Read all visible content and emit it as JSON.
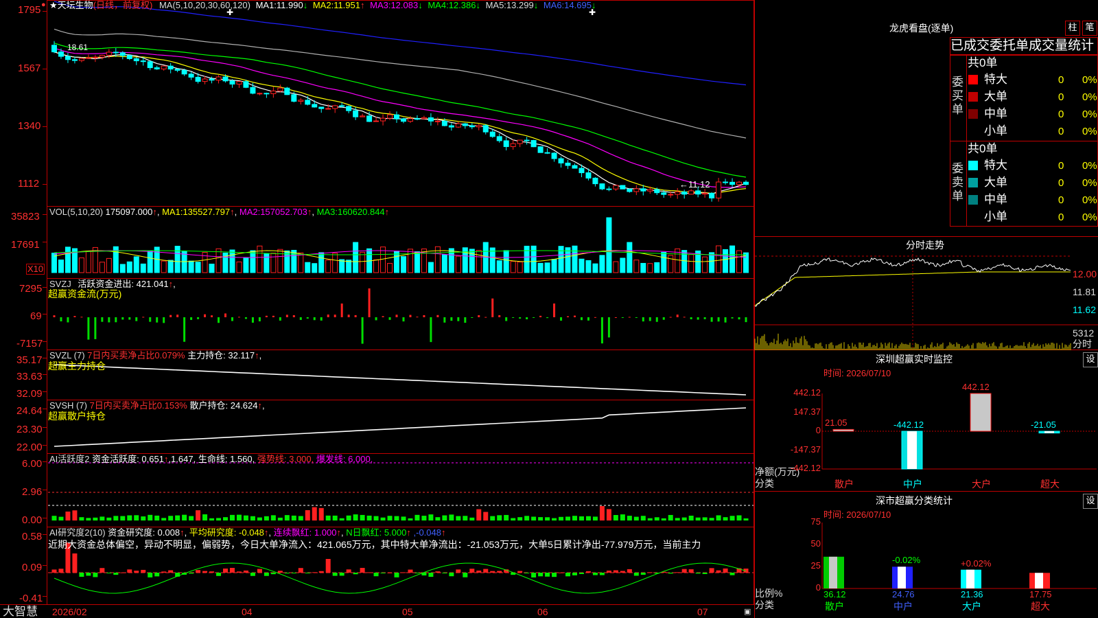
{
  "app": {
    "name": "大智慧",
    "corner_icon": "alert-icon"
  },
  "stock": {
    "star": "★",
    "name": "天坛生物",
    "period": "(日线，前复权)"
  },
  "colors": {
    "up": "#ff2020",
    "down": "#00ffff",
    "ma1": "#ffffff",
    "ma2": "#ffff00",
    "ma3": "#ff00ff",
    "ma4": "#00ff00",
    "ma5": "#b0b0b0",
    "ma6": "#2020ff",
    "panel_border": "#c00000"
  },
  "price_panel": {
    "indicator": "MA(5,10,20,30,60,120)",
    "ma": [
      {
        "name": "MA1:",
        "value": "11.990",
        "arrow": "↓"
      },
      {
        "name": "MA2:",
        "value": "11.951",
        "arrow": "↑"
      },
      {
        "name": "MA3:",
        "value": "12.083",
        "arrow": "↓"
      },
      {
        "name": "MA4:",
        "value": "12.386",
        "arrow": "↓"
      },
      {
        "name": "MA5:",
        "value": "13.299",
        "arrow": "↓"
      },
      {
        "name": "MA6:",
        "value": "14.695",
        "arrow": "↓"
      }
    ],
    "y_ticks": [
      "1795",
      "1567",
      "1340",
      "1112"
    ],
    "high_label": "18.61",
    "low_label": "←11.12"
  },
  "vol_panel": {
    "indicator": "VOL(5,10,20)",
    "value": "175097.000",
    "arrow": "↑",
    "ma": [
      {
        "name": "MA1:",
        "value": "135527.797",
        "arrow": "↑"
      },
      {
        "name": "MA2:",
        "value": "157052.703",
        "arrow": "↑"
      },
      {
        "name": "MA3:",
        "value": "160620.844",
        "arrow": "↑"
      }
    ],
    "y_ticks": [
      "35823",
      "17691"
    ],
    "unit": "X10"
  },
  "svzj_panel": {
    "indicator": "SVZJ",
    "label": "活跃资金进出:",
    "value": "421.041",
    "arrow": "↑",
    ",": ",",
    "subtitle": "超赢资金流(万元)",
    "y_ticks": [
      "7295",
      "69",
      "-7157"
    ]
  },
  "svzl_panel": {
    "indicator": "SVZL (7)",
    "ratio": "7日内买卖净占比0.079%",
    "label": "主力持仓:",
    "value": "32.117",
    "arrow": "↑",
    "sep": ",",
    "subtitle": "超赢主力持仓",
    "y_ticks": [
      "35.17",
      "33.63",
      "32.09"
    ]
  },
  "svsh_panel": {
    "indicator": "SVSH (7)",
    "ratio": "7日内买卖净占比0.153%",
    "label": "散户持仓:",
    "value": "24.624",
    "arrow": "↑",
    "sep": ",",
    "subtitle": "超赢散户持仓",
    "y_ticks": [
      "24.64",
      "23.30",
      "22.00"
    ]
  },
  "ai_active_panel": {
    "indicator": "AI活跃度2",
    "label": "资金活跃度:",
    "v1": "0.651",
    "a1": "↑",
    "v2": ",1.647,",
    "life": "生命线:",
    "life_v": "1.560,",
    "strong": "强势线:",
    "strong_v": "3.000,",
    "burst": "爆发线:",
    "burst_v": "6.000,",
    "y_ticks": [
      "6.00",
      "2.96",
      "0.00"
    ]
  },
  "ai_research_panel": {
    "indicator": "AI研究度2(10)",
    "l1": "资金研究度:",
    "v1": "0.008",
    "a1": "↑",
    "l2": "平均研究度:",
    "v2": "-0.048",
    "a2": "↑",
    "l3": "连续飘红:",
    "v3": "1.000",
    "a3": "↑",
    "l4": "N日飘红:",
    "v4": "5.000",
    "a4": "↑",
    "v5": ",-0.048",
    "a5": "↑",
    "comment": "近期大资金总体偏空，异动不明显，偏弱势，今日大单净流入：421.065万元，其中特大单净流出：-21.053万元，大单5日累计净出-77.979万元，当前主力",
    "y_ticks": [
      "0.58",
      "0.09",
      "-0.41"
    ]
  },
  "x_axis": {
    "labels": [
      "2026/02",
      "04",
      "05",
      "06",
      "07"
    ]
  },
  "dragon": {
    "title": "龙虎看盘(逐单)",
    "btn_col": "柱",
    "btn_pen": "笔",
    "tabs": [
      "已成交",
      "委托单",
      "成交量",
      "统计"
    ],
    "buy": {
      "side": "委买单",
      "total": "共0单",
      "rows": [
        {
          "label": "特大",
          "count": "0",
          "pct": "0%"
        },
        {
          "label": "大单",
          "count": "0",
          "pct": "0%"
        },
        {
          "label": "中单",
          "count": "0",
          "pct": "0%"
        },
        {
          "label": "小单",
          "count": "0",
          "pct": "0%"
        }
      ]
    },
    "sell": {
      "side": "委卖单",
      "total": "共0单",
      "rows": [
        {
          "label": "特大",
          "count": "0",
          "pct": "0%"
        },
        {
          "label": "大单",
          "count": "0",
          "pct": "0%"
        },
        {
          "label": "中单",
          "count": "0",
          "pct": "0%"
        },
        {
          "label": "小单",
          "count": "0",
          "pct": "0%"
        }
      ]
    }
  },
  "intraday": {
    "title": "分时走势",
    "y_ticks": [
      "12.00",
      "11.81",
      "11.62"
    ],
    "vol_tick": "5312",
    "vol_unit": "分时"
  },
  "monitor": {
    "title": "深圳超赢实时监控",
    "set": "设",
    "time": "时间: 2026/07/10",
    "y_ticks": [
      "442.12",
      "147.37",
      "0",
      "-147.37",
      "-442.12"
    ],
    "y_unit": "净额(万元)",
    "x_unit": "分类",
    "categories": [
      "散户",
      "中户",
      "大户",
      "超大"
    ],
    "values": [
      21.05,
      -442.12,
      442.12,
      -21.05
    ],
    "value_labels": [
      "21.05",
      "-442.12",
      "442.12",
      "-21.05"
    ]
  },
  "classify": {
    "title": "深市超赢分类统计",
    "set": "设",
    "time": "时间: 2026/07/10",
    "y_ticks": [
      "75",
      "50",
      "25",
      "0"
    ],
    "y_unit": "比例%",
    "x_unit": "分类",
    "categories": [
      "散户",
      "中户",
      "大户",
      "超大"
    ],
    "values": [
      36.12,
      24.76,
      21.36,
      17.75
    ],
    "top_labels": [
      "",
      "-0.02%",
      "+0.02%",
      ""
    ],
    "bottom_labels": [
      "36.12",
      "24.76",
      "21.36",
      "17.75"
    ]
  }
}
